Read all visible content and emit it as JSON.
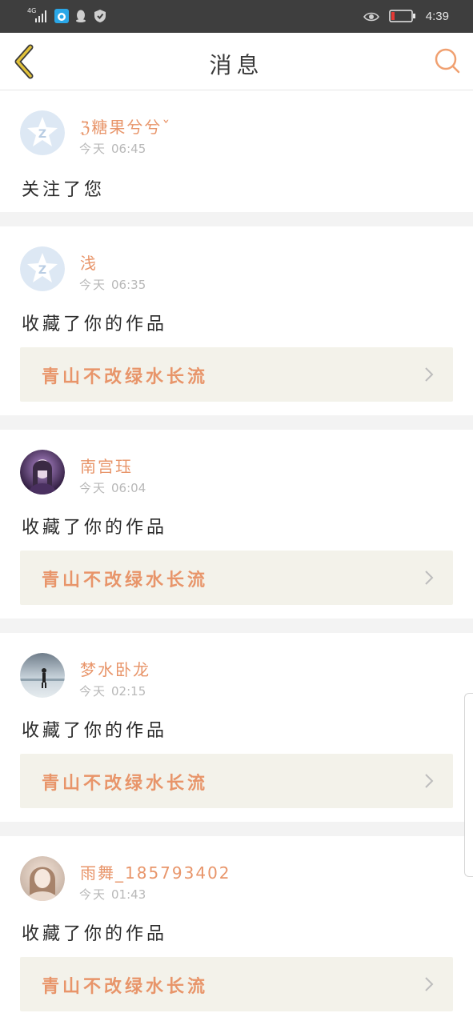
{
  "status_bar": {
    "network": "4G",
    "time": "4:39",
    "icons": [
      "signal-icon",
      "app-notification-icon",
      "qq-icon",
      "shield-icon",
      "eye-icon",
      "battery-icon"
    ],
    "battery_color": "#e53935"
  },
  "header": {
    "title": "消息",
    "back_icon": "chevron-left-icon",
    "search_icon": "search-icon",
    "back_color": "#e2c23a",
    "search_color": "#f0a070"
  },
  "colors": {
    "accent": "#e8956a",
    "card_bg": "#f3f2ea",
    "separator": "#f3f3f3"
  },
  "messages": [
    {
      "name": "ℨ糖果兮兮ˇ",
      "day": "今天",
      "time": "06:45",
      "action": "关注了您",
      "work": null,
      "avatar": "default-avatar"
    },
    {
      "name": "浅",
      "day": "今天",
      "time": "06:35",
      "action": "收藏了你的作品",
      "work": "青山不改绿水长流",
      "avatar": "default-avatar"
    },
    {
      "name": "南宫珏",
      "day": "今天",
      "time": "06:04",
      "action": "收藏了你的作品",
      "work": "青山不改绿水长流",
      "avatar": "photo-avatar"
    },
    {
      "name": "梦水卧龙",
      "day": "今天",
      "time": "02:15",
      "action": "收藏了你的作品",
      "work": "青山不改绿水长流",
      "avatar": "photo-avatar"
    },
    {
      "name": "雨舞_185793402",
      "day": "今天",
      "time": "01:43",
      "action": "收藏了你的作品",
      "work": "青山不改绿水长流",
      "avatar": "photo-avatar"
    }
  ]
}
